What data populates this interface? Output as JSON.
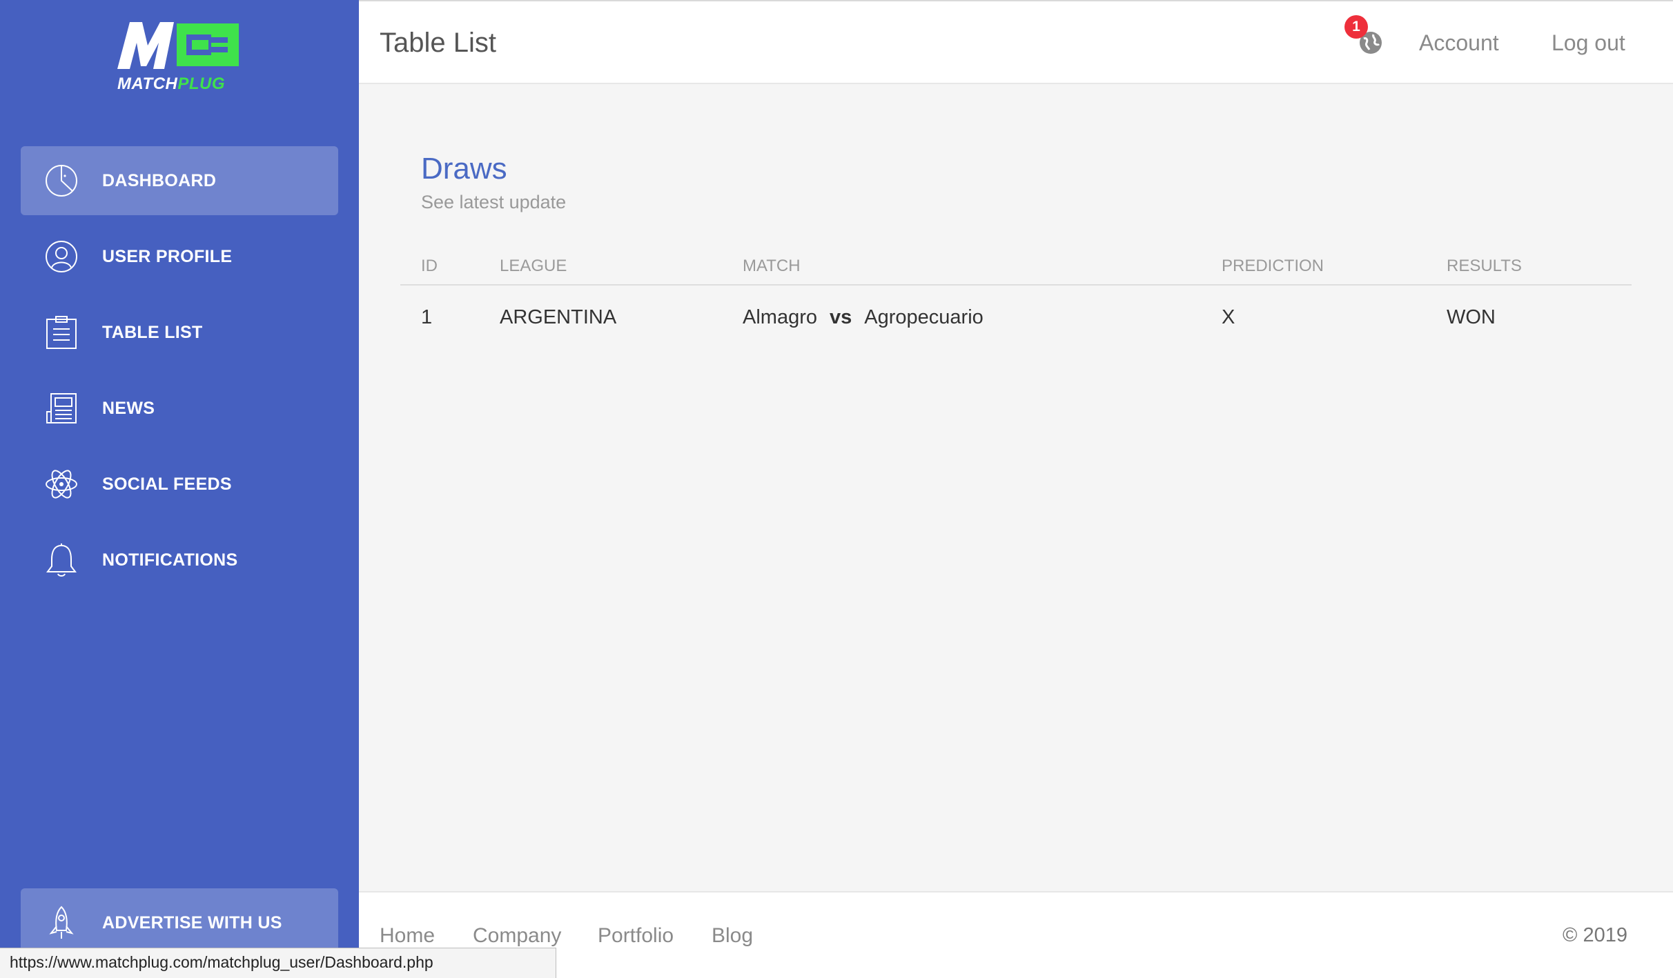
{
  "brand": {
    "name_part1": "MATCH",
    "name_part2": "PLUG",
    "accent_green": "#3fe24b",
    "sidebar_color": "#4660c0"
  },
  "sidebar": {
    "items": [
      {
        "label": "DASHBOARD",
        "icon": "pie-chart-icon",
        "active": true
      },
      {
        "label": "USER PROFILE",
        "icon": "user-icon",
        "active": false
      },
      {
        "label": "TABLE LIST",
        "icon": "clipboard-icon",
        "active": false
      },
      {
        "label": "NEWS",
        "icon": "newspaper-icon",
        "active": false
      },
      {
        "label": "SOCIAL FEEDS",
        "icon": "atom-icon",
        "active": false
      },
      {
        "label": "NOTIFICATIONS",
        "icon": "bell-icon",
        "active": false
      }
    ],
    "advertise": {
      "label": "ADVERTISE WITH US",
      "icon": "rocket-icon"
    }
  },
  "header": {
    "title": "Table List",
    "notification_count": "1",
    "account": "Account",
    "logout": "Log out"
  },
  "main": {
    "card_title": "Draws",
    "card_subtitle": "See latest update",
    "columns": [
      "ID",
      "LEAGUE",
      "MATCH",
      "PREDICTION",
      "RESULTS"
    ],
    "rows": [
      {
        "id": "1",
        "league": "ARGENTINA",
        "home": "Almagro",
        "vs": "vs",
        "away": "Agropecuario",
        "prediction": "X",
        "result": "WON"
      }
    ]
  },
  "footer": {
    "links": [
      "Home",
      "Company",
      "Portfolio",
      "Blog"
    ],
    "copyright": "© 2019"
  },
  "status_url": "https://www.matchplug.com/matchplug_user/Dashboard.php"
}
